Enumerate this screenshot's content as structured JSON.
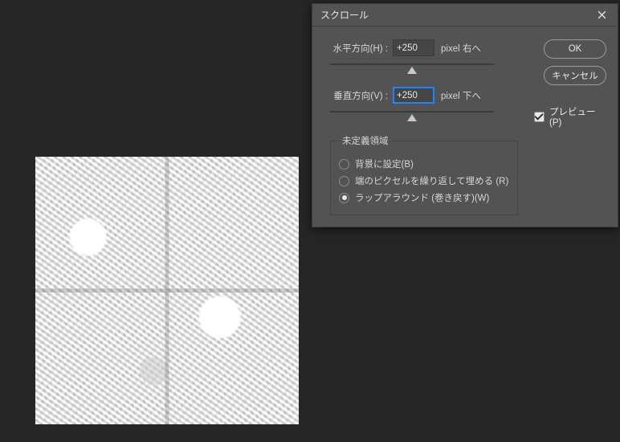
{
  "dialog": {
    "title": "スクロール",
    "horizontal": {
      "label": "水平方向(H) :",
      "value": "+250",
      "unit": "pixel 右へ"
    },
    "vertical": {
      "label": "垂直方向(V) :",
      "value": "+250",
      "unit": "pixel 下へ"
    },
    "undefined_area": {
      "legend": "未定義領域",
      "options": [
        {
          "label": "背景に設定(B)",
          "checked": false
        },
        {
          "label": "端のピクセルを繰り返して埋める (R)",
          "checked": false
        },
        {
          "label": "ラップアラウンド (巻き戻す)(W)",
          "checked": true
        }
      ]
    },
    "buttons": {
      "ok": "OK",
      "cancel": "キャンセル"
    },
    "preview": {
      "label": "プレビュー(P)",
      "checked": true
    }
  }
}
